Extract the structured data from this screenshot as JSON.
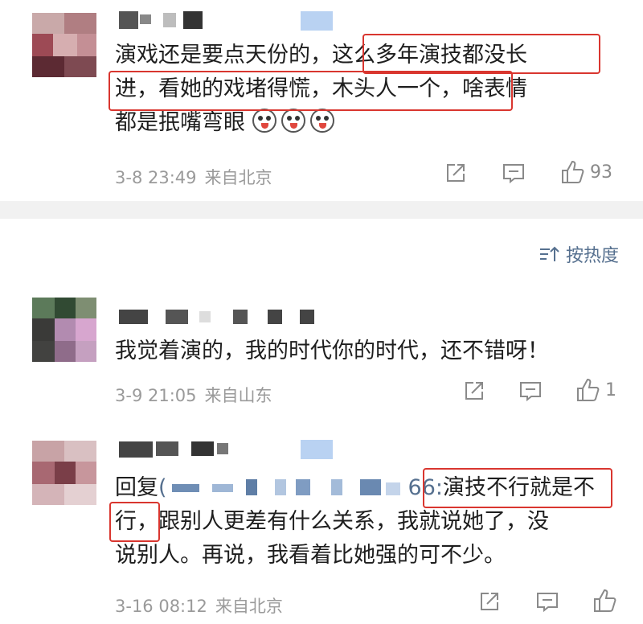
{
  "comments": [
    {
      "text_lines": [
        "演戏还是要点天份的，这么多年演技都没长",
        "进，看她的戏堵得慌，木头人一个，啥表情",
        "都是抿嘴弯眼"
      ],
      "date": "3-8 23:49",
      "location": "来自北京",
      "likes": "93"
    },
    {
      "text_lines": [
        "我觉着演的，我的时代你的时代，还不错呀！"
      ],
      "date": "3-9 21:05",
      "location": "来自山东",
      "likes": "1"
    },
    {
      "reply_prefix": "回复",
      "reply_suffix": "66:",
      "text_lines": [
        "演技不行就是不",
        "行，跟别人更差有什么关系，我就说她了，没",
        "说别人。再说，我看着比她强的可不少。"
      ],
      "date": "3-16 08:12",
      "location": "来自北京",
      "likes": ""
    }
  ],
  "sort": {
    "label": "按热度"
  },
  "icons": [
    "share-icon",
    "comment-icon",
    "like-icon",
    "sort-icon",
    "emoji-icon"
  ],
  "colors": {
    "highlight_box": "#d9362f",
    "link": "#56708f",
    "meta": "#9a9a9a"
  }
}
